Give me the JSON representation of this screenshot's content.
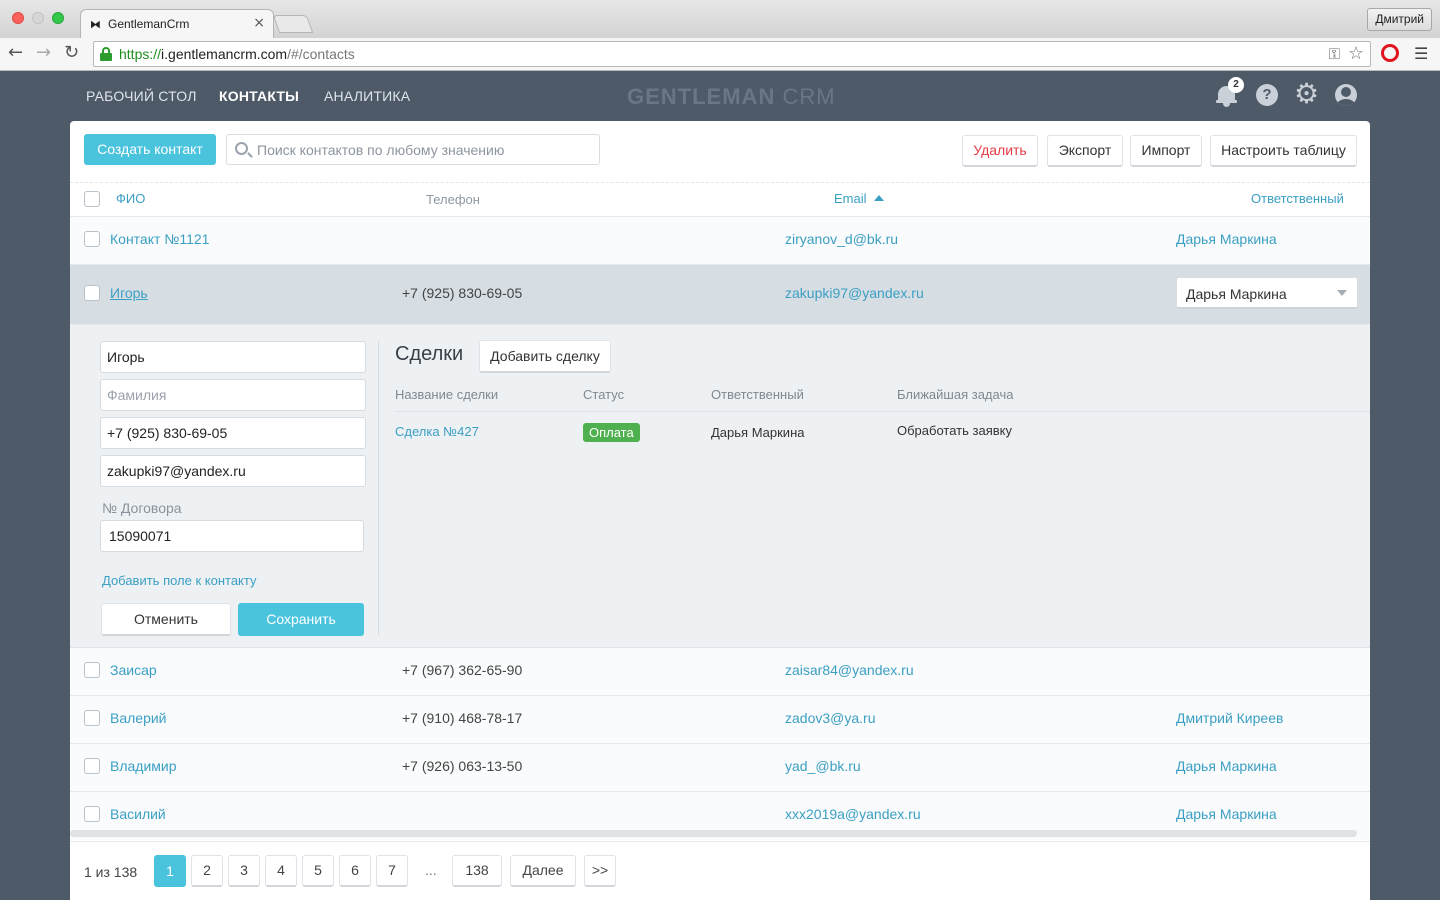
{
  "browser": {
    "tab_title": "GentlemanCrm",
    "tab_favicon": "⧓",
    "profile_name": "Дмитрий",
    "url_scheme": "https://",
    "url_host": "i.gentlemancrm.com",
    "url_path": "/#/contacts"
  },
  "nav": {
    "items": [
      {
        "label": "РАБОЧИЙ СТОЛ"
      },
      {
        "label": "КОНТАКТЫ"
      },
      {
        "label": "АНАЛИТИКА"
      }
    ],
    "logo_bold": "GENTLEMAN",
    "logo_light": " CRM",
    "notification_count": "2",
    "help_glyph": "?",
    "gear_glyph": "⚙"
  },
  "toolbar": {
    "create_label": "Создать контакт",
    "search_placeholder": "Поиск контактов по любому значению",
    "delete_label": "Удалить",
    "export_label": "Экспорт",
    "import_label": "Импорт",
    "config_label": "Настроить таблицу"
  },
  "table": {
    "columns": {
      "name": "ФИО",
      "phone": "Телефон",
      "email": "Email",
      "owner": "Ответственный"
    },
    "rows": [
      {
        "name": "Контакт №1121",
        "phone": "",
        "email": "ziryanov_d@bk.ru",
        "owner": "Дарья Маркина"
      },
      {
        "name": "Игорь",
        "phone": "+7 (925) 830-69-05",
        "email": "zakupki97@yandex.ru",
        "owner": "Дарья Маркина"
      },
      {
        "name": "Заисар",
        "phone": "+7 (967) 362-65-90",
        "email": "zaisar84@yandex.ru",
        "owner": ""
      },
      {
        "name": "Валерий",
        "phone": "+7 (910) 468-78-17",
        "email": "zadov3@ya.ru",
        "owner": "Дмитрий Киреев"
      },
      {
        "name": "Владимир",
        "phone": "+7 (926) 063-13-50",
        "email": "yad_@bk.ru",
        "owner": "Дарья Маркина"
      },
      {
        "name": "Василий",
        "phone": "",
        "email": "xxx2019a@yandex.ru",
        "owner": "Дарья Маркина"
      }
    ]
  },
  "editor": {
    "first_name": "Игорь",
    "last_name_placeholder": "Фамилия",
    "phone": "+7 (925) 830-69-05",
    "email": "zakupki97@yandex.ru",
    "contract_label": "№ Договора",
    "contract_value": "15090071",
    "add_field_label": "Добавить поле к контакту",
    "cancel_label": "Отменить",
    "save_label": "Сохранить"
  },
  "deals": {
    "title": "Сделки",
    "add_label": "Добавить сделку",
    "columns": {
      "name": "Название сделки",
      "status": "Статус",
      "owner": "Ответственный",
      "task": "Ближайшая задача"
    },
    "items": [
      {
        "name": "Сделка №427",
        "status": "Оплата",
        "owner": "Дарья Маркина",
        "task": "Обработать заявку"
      }
    ]
  },
  "pagination": {
    "info": "1 из 138",
    "pages": [
      "1",
      "2",
      "3",
      "4",
      "5",
      "6",
      "7"
    ],
    "ellipsis": "...",
    "last": "138",
    "next_label": "Далее",
    "end_label": ">>"
  },
  "colors": {
    "accent": "#4ac3dd",
    "link": "#3b9fc4",
    "danger": "#e43b45",
    "status_green": "#4fb04f",
    "app_bg": "#4e5a68"
  }
}
